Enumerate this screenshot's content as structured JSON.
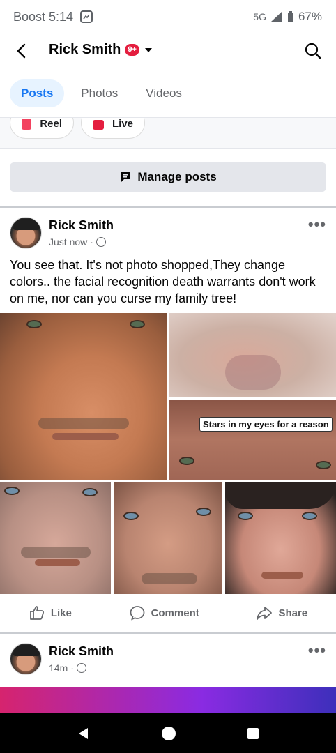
{
  "status_bar": {
    "carrier_time": "Boost 5:14",
    "network": "5G",
    "battery": "67%"
  },
  "header": {
    "title": "Rick Smith",
    "badge": "9+"
  },
  "tabs": [
    {
      "label": "Posts",
      "active": true
    },
    {
      "label": "Photos",
      "active": false
    },
    {
      "label": "Videos",
      "active": false
    }
  ],
  "create": {
    "reel_label": "Reel",
    "live_label": "Live"
  },
  "manage_posts_label": "Manage posts",
  "posts": [
    {
      "author": "Rick Smith",
      "time": "Just now",
      "text": "You see that. It's not photo shopped,They change colors..  the facial recognition death warrants don't work on me, nor can you curse my family tree!",
      "sticker_text": "Stars in my eyes for a reason"
    },
    {
      "author": "Rick Smith",
      "time": "14m"
    }
  ],
  "actions": {
    "like": "Like",
    "comment": "Comment",
    "share": "Share"
  },
  "colors": {
    "accent": "#1877f2",
    "badge": "#e41e3f"
  }
}
